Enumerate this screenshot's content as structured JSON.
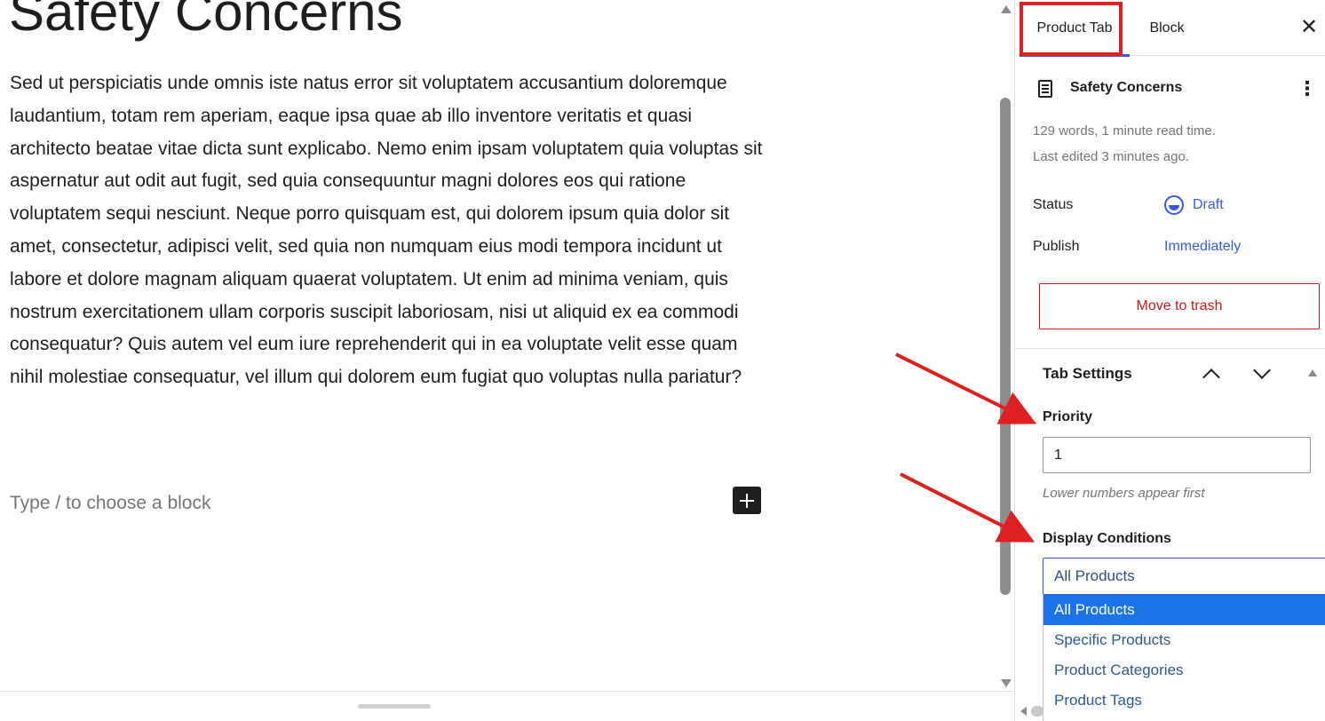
{
  "editor": {
    "post_title": "Safety Concerns",
    "post_body": "Sed ut perspiciatis unde omnis iste natus error sit voluptatem accusantium doloremque laudantium, totam rem aperiam, eaque ipsa quae ab illo inventore veritatis et quasi architecto beatae vitae dicta sunt explicabo. Nemo enim ipsam voluptatem quia voluptas sit aspernatur aut odit aut fugit, sed quia consequuntur magni dolores eos qui ratione voluptatem sequi nesciunt. Neque porro quisquam est, qui dolorem ipsum quia dolor sit amet, consectetur, adipisci velit, sed quia non numquam eius modi tempora incidunt ut labore et dolore magnam aliquam quaerat voluptatem. Ut enim ad minima veniam, quis nostrum exercitationem ullam corporis suscipit laboriosam, nisi ut aliquid ex ea commodi consequatur? Quis autem vel eum iure reprehenderit qui in ea voluptate velit esse quam nihil molestiae consequatur, vel illum qui dolorem eum fugiat quo voluptas nulla pariatur?",
    "block_placeholder": "Type / to choose a block",
    "inserter_icon": "plus-icon"
  },
  "sidebar": {
    "tabs": [
      {
        "label": "Product Tab",
        "active": true
      },
      {
        "label": "Block",
        "active": false
      }
    ],
    "close_icon": "close-icon",
    "document": {
      "title": "Safety Concerns",
      "icon": "document-icon",
      "words_info": "129 words, 1 minute read time.",
      "last_edited": "Last edited 3 minutes ago."
    },
    "status": {
      "label": "Status",
      "value": "Draft"
    },
    "publish": {
      "label": "Publish",
      "value": "Immediately"
    },
    "trash_label": "Move to trash",
    "tab_settings": {
      "title": "Tab Settings",
      "priority_label": "Priority",
      "priority_value": "1",
      "priority_help": "Lower numbers appear first",
      "display_label": "Display Conditions",
      "display_selected": "All Products",
      "display_options": [
        "All Products",
        "Specific Products",
        "Product Categories",
        "Product Tags"
      ]
    }
  },
  "colors": {
    "accent": "#3858e9",
    "danger": "#cc1818",
    "annotation": "#e02020",
    "option_selected_bg": "#1a73e8"
  }
}
